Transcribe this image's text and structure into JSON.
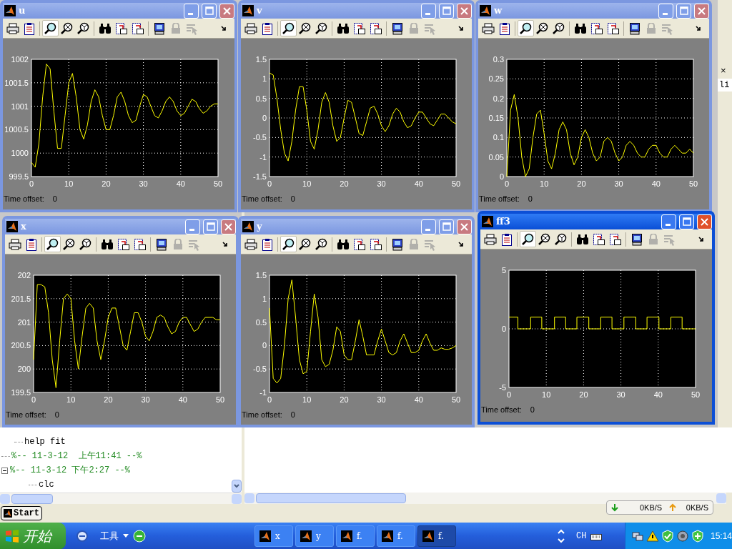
{
  "windows": [
    {
      "title": "u",
      "active": false,
      "toolbar": [
        {
          "kind": "print",
          "selected": false,
          "disabled": false
        },
        {
          "kind": "params",
          "selected": false,
          "disabled": false
        },
        {
          "kind": "zoom",
          "selected": true,
          "disabled": false
        },
        {
          "kind": "zoom-x",
          "selected": false,
          "disabled": false
        },
        {
          "kind": "zoom-y",
          "selected": false,
          "disabled": false
        },
        {
          "kind": "autoscale",
          "selected": false,
          "disabled": false
        },
        {
          "kind": "save-axes",
          "selected": false,
          "disabled": false
        },
        {
          "kind": "restore-axes",
          "selected": false,
          "disabled": false
        },
        {
          "kind": "float",
          "selected": false,
          "disabled": false
        },
        {
          "kind": "lock",
          "selected": false,
          "disabled": true
        },
        {
          "kind": "select",
          "selected": false,
          "disabled": true
        },
        {
          "kind": "more",
          "selected": false,
          "disabled": false
        }
      ],
      "chart_data": {
        "type": "line",
        "x": [
          0,
          1,
          2,
          3,
          4,
          5,
          6,
          7,
          8,
          9,
          10,
          11,
          12,
          13,
          14,
          15,
          16,
          17,
          18,
          19,
          20,
          21,
          22,
          23,
          24,
          25,
          26,
          27,
          28,
          29,
          30,
          31,
          32,
          33,
          34,
          35,
          36,
          37,
          38,
          39,
          40,
          41,
          42,
          43,
          44,
          45,
          46,
          47,
          48,
          49,
          50
        ],
        "series": [
          {
            "color": "#ffff00",
            "values": [
              999.8,
              999.7,
              1000.2,
              1001.2,
              1001.9,
              1001.8,
              1000.9,
              1000.1,
              1000.1,
              1000.8,
              1001.5,
              1001.7,
              1001.2,
              1000.5,
              1000.3,
              1000.6,
              1001.1,
              1001.35,
              1001.2,
              1000.8,
              1000.5,
              1000.5,
              1000.8,
              1001.2,
              1001.3,
              1001.1,
              1000.8,
              1000.65,
              1000.7,
              1001.0,
              1001.25,
              1001.2,
              1001.0,
              1000.8,
              1000.75,
              1000.9,
              1001.1,
              1001.2,
              1001.1,
              1000.9,
              1000.8,
              1000.85,
              1001.0,
              1001.15,
              1001.1,
              1000.95,
              1000.85,
              1000.9,
              1001.0,
              1001.05,
              1001.05
            ]
          }
        ],
        "grid": true,
        "xlim": [
          0,
          50
        ],
        "ylim": [
          999.5,
          1002
        ],
        "xticks": [
          0,
          10,
          20,
          30,
          40,
          50
        ],
        "yticks": [
          {
            "value": 999.5,
            "label": "999.5"
          },
          {
            "value": 1000,
            "label": "1000"
          },
          {
            "value": 1000.5,
            "label": "1000.5"
          },
          {
            "value": 1001,
            "label": "1001"
          },
          {
            "value": 1001.5,
            "label": "1001.5"
          },
          {
            "value": 1002,
            "label": "1002"
          }
        ]
      },
      "time_offset_label": "Time offset:",
      "time_offset_value": "0"
    },
    {
      "title": "v",
      "active": false,
      "toolbar": [
        {
          "kind": "print",
          "selected": false,
          "disabled": false
        },
        {
          "kind": "params",
          "selected": false,
          "disabled": false
        },
        {
          "kind": "zoom",
          "selected": true,
          "disabled": false
        },
        {
          "kind": "zoom-x",
          "selected": false,
          "disabled": false
        },
        {
          "kind": "zoom-y",
          "selected": false,
          "disabled": false
        },
        {
          "kind": "autoscale",
          "selected": false,
          "disabled": false
        },
        {
          "kind": "save-axes",
          "selected": false,
          "disabled": false
        },
        {
          "kind": "restore-axes",
          "selected": false,
          "disabled": false
        },
        {
          "kind": "float",
          "selected": false,
          "disabled": false
        },
        {
          "kind": "lock",
          "selected": false,
          "disabled": true
        },
        {
          "kind": "select",
          "selected": false,
          "disabled": true
        },
        {
          "kind": "more",
          "selected": false,
          "disabled": false
        }
      ],
      "chart_data": {
        "type": "line",
        "x": [
          0,
          1,
          2,
          3,
          4,
          5,
          6,
          7,
          8,
          9,
          10,
          11,
          12,
          13,
          14,
          15,
          16,
          17,
          18,
          19,
          20,
          21,
          22,
          23,
          24,
          25,
          26,
          27,
          28,
          29,
          30,
          31,
          32,
          33,
          34,
          35,
          36,
          37,
          38,
          39,
          40,
          41,
          42,
          43,
          44,
          45,
          46,
          47,
          48,
          49,
          50
        ],
        "series": [
          {
            "color": "#ffff00",
            "values": [
              1.15,
              1.1,
              0.5,
              -0.3,
              -0.9,
              -1.1,
              -0.6,
              0.2,
              0.8,
              0.8,
              0.2,
              -0.6,
              -0.8,
              -0.3,
              0.4,
              0.65,
              0.4,
              -0.2,
              -0.6,
              -0.5,
              0.0,
              0.45,
              0.4,
              0.0,
              -0.4,
              -0.45,
              -0.1,
              0.25,
              0.3,
              0.1,
              -0.2,
              -0.35,
              -0.2,
              0.1,
              0.25,
              0.15,
              -0.1,
              -0.25,
              -0.2,
              0.0,
              0.15,
              0.15,
              0.0,
              -0.15,
              -0.2,
              -0.05,
              0.1,
              0.1,
              0.0,
              -0.1,
              -0.15
            ]
          }
        ],
        "grid": true,
        "xlim": [
          0,
          50
        ],
        "ylim": [
          -1.5,
          1.5
        ],
        "xticks": [
          0,
          10,
          20,
          30,
          40,
          50
        ],
        "yticks": [
          -1.5,
          -1,
          -0.5,
          0,
          0.5,
          1,
          1.5
        ]
      },
      "time_offset_label": "Time offset:",
      "time_offset_value": "0"
    },
    {
      "title": "w",
      "active": false,
      "toolbar": [
        {
          "kind": "print",
          "selected": false,
          "disabled": false
        },
        {
          "kind": "params",
          "selected": false,
          "disabled": false
        },
        {
          "kind": "zoom",
          "selected": true,
          "disabled": false
        },
        {
          "kind": "zoom-x",
          "selected": false,
          "disabled": false
        },
        {
          "kind": "zoom-y",
          "selected": false,
          "disabled": false
        },
        {
          "kind": "autoscale",
          "selected": false,
          "disabled": false
        },
        {
          "kind": "save-axes",
          "selected": false,
          "disabled": false
        },
        {
          "kind": "restore-axes",
          "selected": false,
          "disabled": false
        },
        {
          "kind": "float",
          "selected": false,
          "disabled": false
        },
        {
          "kind": "lock",
          "selected": false,
          "disabled": true
        },
        {
          "kind": "select",
          "selected": false,
          "disabled": true
        },
        {
          "kind": "more",
          "selected": false,
          "disabled": false
        }
      ],
      "chart_data": {
        "type": "line",
        "x": [
          0,
          1,
          2,
          3,
          4,
          5,
          6,
          7,
          8,
          9,
          10,
          11,
          12,
          13,
          14,
          15,
          16,
          17,
          18,
          19,
          20,
          21,
          22,
          23,
          24,
          25,
          26,
          27,
          28,
          29,
          30,
          31,
          32,
          33,
          34,
          35,
          36,
          37,
          38,
          39,
          40,
          41,
          42,
          43,
          44,
          45,
          46,
          47,
          48,
          49,
          50
        ],
        "series": [
          {
            "color": "#ffff00",
            "values": [
              0.0,
              0.17,
              0.21,
              0.15,
              0.05,
              0.0,
              0.02,
              0.1,
              0.16,
              0.17,
              0.11,
              0.04,
              0.02,
              0.06,
              0.12,
              0.14,
              0.12,
              0.06,
              0.03,
              0.05,
              0.1,
              0.12,
              0.1,
              0.06,
              0.04,
              0.05,
              0.09,
              0.1,
              0.09,
              0.06,
              0.04,
              0.05,
              0.08,
              0.09,
              0.08,
              0.06,
              0.05,
              0.05,
              0.07,
              0.08,
              0.08,
              0.06,
              0.05,
              0.05,
              0.07,
              0.08,
              0.07,
              0.06,
              0.06,
              0.07,
              0.06
            ]
          }
        ],
        "grid": true,
        "xlim": [
          0,
          50
        ],
        "ylim": [
          0,
          0.3
        ],
        "xticks": [
          0,
          10,
          20,
          30,
          40,
          50
        ],
        "yticks": [
          0,
          0.05,
          0.1,
          0.15,
          0.2,
          0.25,
          0.3
        ]
      },
      "time_offset_label": "Time offset:",
      "time_offset_value": "0"
    },
    {
      "title": "x",
      "active": false,
      "toolbar": [
        {
          "kind": "print",
          "selected": false,
          "disabled": false
        },
        {
          "kind": "params",
          "selected": false,
          "disabled": false
        },
        {
          "kind": "zoom",
          "selected": true,
          "disabled": false
        },
        {
          "kind": "zoom-x",
          "selected": false,
          "disabled": false
        },
        {
          "kind": "zoom-y",
          "selected": false,
          "disabled": false
        },
        {
          "kind": "autoscale",
          "selected": false,
          "disabled": false
        },
        {
          "kind": "save-axes",
          "selected": false,
          "disabled": false
        },
        {
          "kind": "restore-axes",
          "selected": false,
          "disabled": false
        },
        {
          "kind": "float",
          "selected": false,
          "disabled": false
        },
        {
          "kind": "lock",
          "selected": false,
          "disabled": true
        },
        {
          "kind": "select",
          "selected": false,
          "disabled": true
        },
        {
          "kind": "more",
          "selected": false,
          "disabled": false
        }
      ],
      "chart_data": {
        "type": "line",
        "x": [
          0,
          1,
          2,
          3,
          4,
          5,
          6,
          7,
          8,
          9,
          10,
          11,
          12,
          13,
          14,
          15,
          16,
          17,
          18,
          19,
          20,
          21,
          22,
          23,
          24,
          25,
          26,
          27,
          28,
          29,
          30,
          31,
          32,
          33,
          34,
          35,
          36,
          37,
          38,
          39,
          40,
          41,
          42,
          43,
          44,
          45,
          46,
          47,
          48,
          49,
          50
        ],
        "series": [
          {
            "color": "#ffff00",
            "values": [
              200.2,
              201.8,
              201.8,
              201.75,
              201.2,
              200.2,
              199.6,
              200.6,
              201.5,
              201.6,
              201.5,
              200.6,
              200.0,
              200.7,
              201.3,
              201.4,
              201.3,
              200.6,
              200.2,
              200.6,
              201.1,
              201.3,
              201.3,
              200.9,
              200.5,
              200.4,
              200.8,
              201.2,
              201.2,
              201.0,
              200.7,
              200.6,
              200.8,
              201.1,
              201.15,
              201.1,
              200.9,
              200.75,
              200.8,
              201.0,
              201.1,
              201.1,
              200.95,
              200.8,
              200.85,
              201.0,
              201.1,
              201.1,
              201.1,
              201.05,
              201.05
            ]
          }
        ],
        "grid": true,
        "xlim": [
          0,
          50
        ],
        "ylim": [
          199.5,
          202
        ],
        "xticks": [
          0,
          10,
          20,
          30,
          40,
          50
        ],
        "yticks": [
          {
            "value": 199.5,
            "label": "199.5"
          },
          {
            "value": 200,
            "label": "200"
          },
          {
            "value": 200.5,
            "label": "200.5"
          },
          {
            "value": 201,
            "label": "201"
          },
          {
            "value": 201.5,
            "label": "201.5"
          },
          {
            "value": 202,
            "label": "202"
          }
        ]
      },
      "time_offset_label": "Time offset:",
      "time_offset_value": "0"
    },
    {
      "title": "y",
      "active": false,
      "toolbar": [
        {
          "kind": "print",
          "selected": false,
          "disabled": false
        },
        {
          "kind": "params",
          "selected": false,
          "disabled": false
        },
        {
          "kind": "zoom",
          "selected": true,
          "disabled": false
        },
        {
          "kind": "zoom-x",
          "selected": false,
          "disabled": false
        },
        {
          "kind": "zoom-y",
          "selected": false,
          "disabled": false
        },
        {
          "kind": "autoscale",
          "selected": false,
          "disabled": false
        },
        {
          "kind": "save-axes",
          "selected": false,
          "disabled": false
        },
        {
          "kind": "restore-axes",
          "selected": false,
          "disabled": false
        },
        {
          "kind": "float",
          "selected": false,
          "disabled": false
        },
        {
          "kind": "lock",
          "selected": false,
          "disabled": true
        },
        {
          "kind": "select",
          "selected": false,
          "disabled": true
        },
        {
          "kind": "more",
          "selected": false,
          "disabled": false
        }
      ],
      "chart_data": {
        "type": "line",
        "x": [
          0,
          1,
          2,
          3,
          4,
          5,
          6,
          7,
          8,
          9,
          10,
          11,
          12,
          13,
          14,
          15,
          16,
          17,
          18,
          19,
          20,
          21,
          22,
          23,
          24,
          25,
          26,
          27,
          28,
          29,
          30,
          31,
          32,
          33,
          34,
          35,
          36,
          37,
          38,
          39,
          40,
          41,
          42,
          43,
          44,
          45,
          46,
          47,
          48,
          49,
          50
        ],
        "series": [
          {
            "color": "#ffff00",
            "values": [
              0.8,
              -0.7,
              -0.8,
              -0.7,
              0.0,
              1.0,
              1.4,
              0.6,
              -0.3,
              -0.6,
              -0.55,
              0.3,
              1.1,
              0.6,
              -0.3,
              -0.45,
              -0.4,
              -0.1,
              0.4,
              0.3,
              -0.2,
              -0.3,
              -0.3,
              0.1,
              0.55,
              0.2,
              -0.2,
              -0.2,
              -0.2,
              0.1,
              0.35,
              0.1,
              -0.15,
              -0.2,
              -0.15,
              0.1,
              0.25,
              0.05,
              -0.15,
              -0.15,
              -0.1,
              0.1,
              0.25,
              0.05,
              -0.1,
              -0.1,
              -0.05,
              -0.08,
              -0.08,
              -0.05,
              0.0
            ]
          }
        ],
        "grid": true,
        "xlim": [
          0,
          50
        ],
        "ylim": [
          -1,
          1.5
        ],
        "xticks": [
          0,
          10,
          20,
          30,
          40,
          50
        ],
        "yticks": [
          -1,
          -0.5,
          0,
          0.5,
          1,
          1.5
        ]
      },
      "time_offset_label": "Time offset:",
      "time_offset_value": "0"
    },
    {
      "title": "ff3",
      "active": true,
      "toolbar": [
        {
          "kind": "print",
          "selected": false,
          "disabled": false
        },
        {
          "kind": "params",
          "selected": false,
          "disabled": false
        },
        {
          "kind": "zoom",
          "selected": true,
          "disabled": false
        },
        {
          "kind": "zoom-x",
          "selected": false,
          "disabled": false
        },
        {
          "kind": "zoom-y",
          "selected": false,
          "disabled": false
        },
        {
          "kind": "autoscale",
          "selected": false,
          "disabled": false
        },
        {
          "kind": "save-axes",
          "selected": false,
          "disabled": false
        },
        {
          "kind": "restore-axes",
          "selected": false,
          "disabled": false
        },
        {
          "kind": "float",
          "selected": false,
          "disabled": false
        },
        {
          "kind": "lock",
          "selected": false,
          "disabled": true
        },
        {
          "kind": "select",
          "selected": false,
          "disabled": true
        },
        {
          "kind": "more",
          "selected": false,
          "disabled": false
        }
      ],
      "chart_data": {
        "type": "line",
        "x": [
          0,
          2.4,
          2.4,
          5.8,
          5.8,
          8.8,
          8.8,
          12.2,
          12.2,
          15.2,
          15.2,
          18.2,
          18.2,
          21.4,
          21.4,
          24.6,
          24.6,
          27.6,
          27.6,
          30.8,
          30.8,
          34,
          34,
          37,
          37,
          40.2,
          40.2,
          43.4,
          43.4,
          46.4,
          46.4,
          50
        ],
        "series": [
          {
            "color": "#ffff00",
            "values": [
              1,
              1,
              0,
              0,
              1,
              1,
              0,
              0,
              1,
              1,
              0,
              0,
              1,
              1,
              0,
              0,
              1,
              1,
              0,
              0,
              1,
              1,
              0,
              0,
              1,
              1,
              0,
              0,
              1,
              1,
              0,
              0
            ]
          }
        ],
        "grid": true,
        "xlim": [
          0,
          50
        ],
        "ylim": [
          -5,
          5
        ],
        "xticks": [
          0,
          10,
          20,
          30,
          40,
          50
        ],
        "yticks": [
          -5,
          0,
          5
        ]
      },
      "time_offset_label": "Time offset:",
      "time_offset_value": "0"
    }
  ],
  "command_history": {
    "items": [
      {
        "kind": "command",
        "text": "help fit"
      },
      {
        "kind": "session",
        "text": "%-- 11-3-12  上午11:41 --%"
      },
      {
        "kind": "session",
        "text": "%-- 11-3-12 下午2:27 --%",
        "children": [
          {
            "kind": "command",
            "text": "clc"
          }
        ]
      }
    ]
  },
  "side_panel": {
    "close": "×",
    "text": "li"
  },
  "start_button": "Start",
  "net_meter": {
    "down": "0KB/S",
    "up": "0KB/S"
  },
  "taskbar": {
    "start": "开始",
    "toolbar_label": "工具",
    "tasks": [
      {
        "label": "x",
        "selected": false
      },
      {
        "label": "y",
        "selected": false
      },
      {
        "label": "f.",
        "selected": false
      },
      {
        "label": "f.",
        "selected": false
      },
      {
        "label": "f.",
        "selected": true
      }
    ],
    "language": "CH",
    "clock": "15:14"
  }
}
